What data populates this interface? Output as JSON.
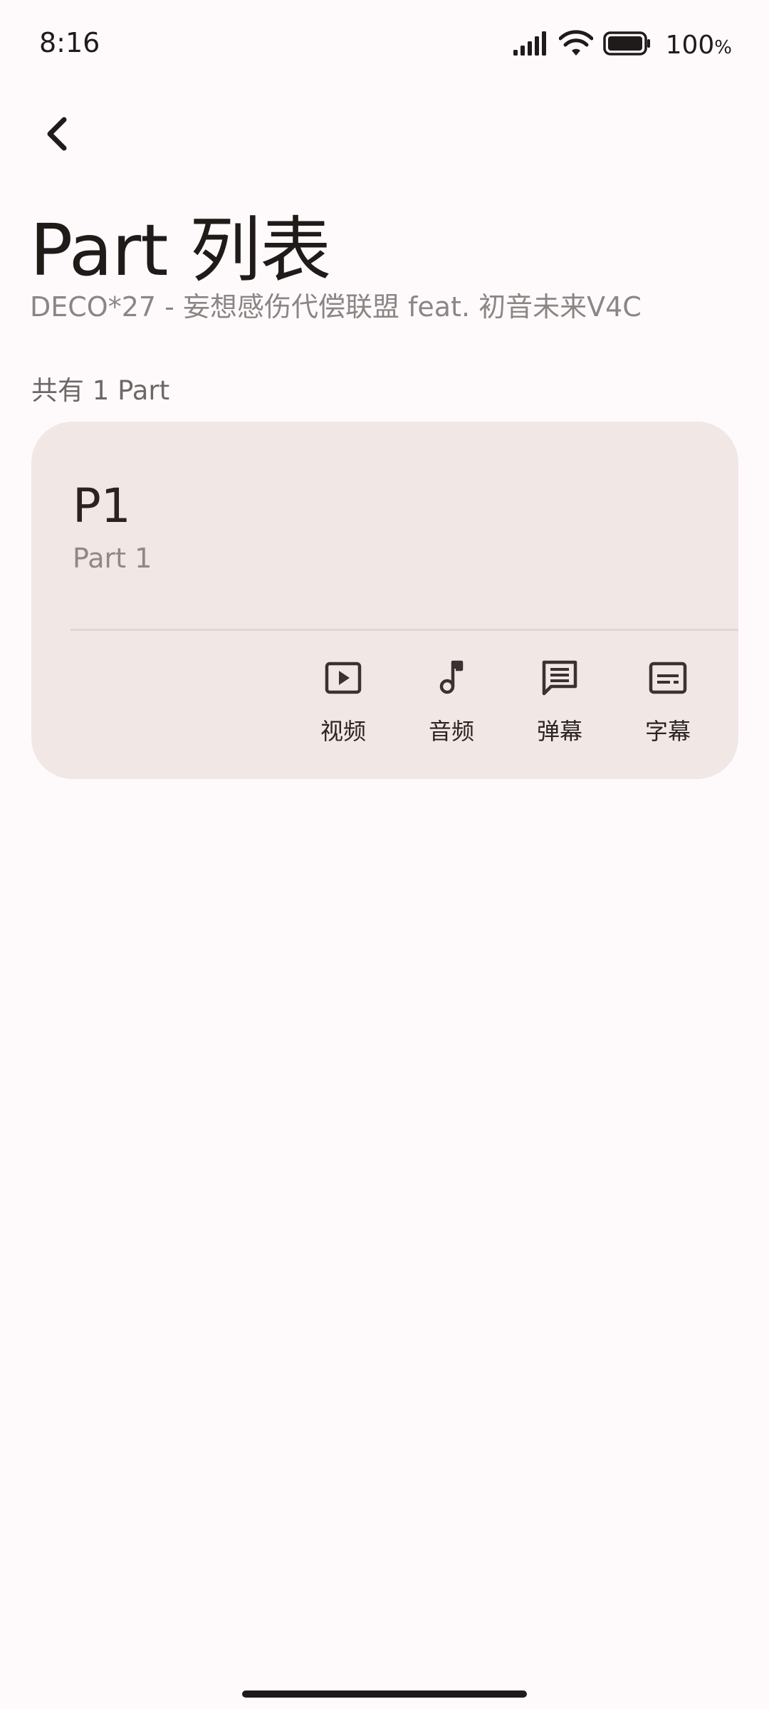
{
  "status_bar": {
    "time": "8:16",
    "battery_percent": "100",
    "battery_symbol": "%"
  },
  "header": {
    "title": "Part 列表",
    "subtitle": "DECO*27 - 妄想感伤代偿联盟 feat. 初音未来V4C"
  },
  "list": {
    "count_text": "共有 1 Part",
    "parts": [
      {
        "title": "P1",
        "name": "Part 1",
        "actions": [
          {
            "label": "视频",
            "icon": "video-icon"
          },
          {
            "label": "音频",
            "icon": "music-note-icon"
          },
          {
            "label": "弹幕",
            "icon": "comment-icon"
          },
          {
            "label": "字幕",
            "icon": "subtitles-icon"
          }
        ]
      }
    ]
  },
  "colors": {
    "background": "#fefafc",
    "card": "#f1e7e5",
    "text_primary": "#201a19",
    "text_secondary": "#8b8584"
  }
}
